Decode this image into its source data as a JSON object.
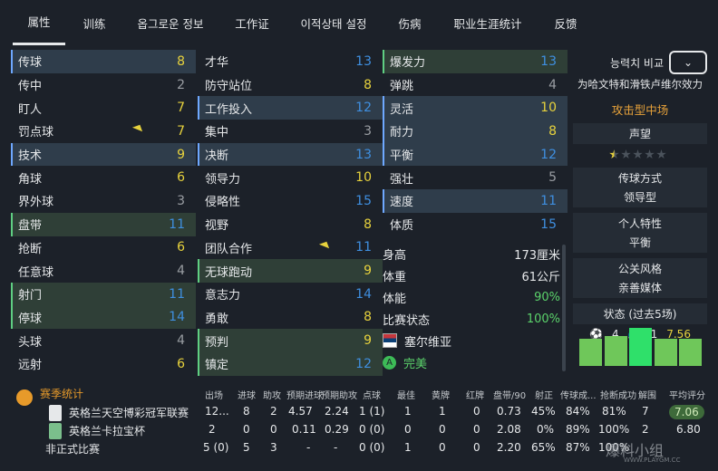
{
  "tabs": [
    "属性",
    "训练",
    "옵그로운 정보",
    "工作证",
    "이적상태 설정",
    "伤病",
    "职业生涯统计",
    "反馈"
  ],
  "technical": [
    {
      "name": "传球",
      "value": "8"
    },
    {
      "name": "传中",
      "value": "2"
    },
    {
      "name": "盯人",
      "value": "7"
    },
    {
      "name": "罚点球",
      "value": "7"
    },
    {
      "name": "技术",
      "value": "9"
    },
    {
      "name": "角球",
      "value": "6"
    },
    {
      "name": "界外球",
      "value": "3"
    },
    {
      "name": "盘带",
      "value": "11"
    },
    {
      "name": "抢断",
      "value": "6"
    },
    {
      "name": "任意球",
      "value": "4"
    },
    {
      "name": "射门",
      "value": "11"
    },
    {
      "name": "停球",
      "value": "14"
    },
    {
      "name": "头球",
      "value": "4"
    },
    {
      "name": "远射",
      "value": "6"
    }
  ],
  "mental": [
    {
      "name": "才华",
      "value": "13"
    },
    {
      "name": "防守站位",
      "value": "8"
    },
    {
      "name": "工作投入",
      "value": "12"
    },
    {
      "name": "集中",
      "value": "3"
    },
    {
      "name": "决断",
      "value": "13"
    },
    {
      "name": "领导力",
      "value": "10"
    },
    {
      "name": "侵略性",
      "value": "15"
    },
    {
      "name": "视野",
      "value": "8"
    },
    {
      "name": "团队合作",
      "value": "11"
    },
    {
      "name": "无球跑动",
      "value": "9"
    },
    {
      "name": "意志力",
      "value": "14"
    },
    {
      "name": "勇敢",
      "value": "8"
    },
    {
      "name": "预判",
      "value": "9"
    },
    {
      "name": "镇定",
      "value": "12"
    }
  ],
  "physical": [
    {
      "name": "爆发力",
      "value": "13"
    },
    {
      "name": "弹跳",
      "value": "4"
    },
    {
      "name": "灵活",
      "value": "10"
    },
    {
      "name": "耐力",
      "value": "8"
    },
    {
      "name": "平衡",
      "value": "12"
    },
    {
      "name": "强壮",
      "value": "5"
    },
    {
      "name": "速度",
      "value": "11"
    },
    {
      "name": "体质",
      "value": "15"
    }
  ],
  "info": {
    "height_label": "身高",
    "height": "173厘米",
    "weight_label": "体重",
    "weight": "61公斤",
    "fitness_label": "体能",
    "fitness": "90%",
    "condition_label": "比赛状态",
    "condition": "100%",
    "nation": "塞尔维亚",
    "status": "完美"
  },
  "right": {
    "compare_label": "능력치 비교",
    "club_text": "为哈文特和滑铁卢维尔效力",
    "role": "攻击型中场",
    "reputation_label": "声望",
    "reputation_stars": 0.5,
    "passing_label": "传球方式",
    "passing_value": "领导型",
    "trait_label": "个人特性",
    "trait_value": "平衡",
    "pr_label": "公关风格",
    "pr_value": "亲善媒体",
    "form_label": "状态 (过去5场)",
    "form_goals": "4",
    "form_assists": "1",
    "form_rating": "7.56",
    "form_bars": [
      0.72,
      0.78,
      1.0,
      0.72,
      0.72
    ]
  },
  "season": {
    "title": "赛季统计",
    "headers": [
      "出场",
      "进球",
      "助攻",
      "预期进球",
      "预期助攻",
      "点球",
      "最佳",
      "黄牌",
      "红牌",
      "盘带/90",
      "射正",
      "传球成...",
      "抢断成功",
      "解围",
      "平均评分"
    ],
    "rows": [
      {
        "name": "英格兰天空博彩冠军联赛",
        "cells": [
          "12...",
          "8",
          "2",
          "4.57",
          "2.24",
          "1 (1)",
          "1",
          "1",
          "0",
          "0.73",
          "45%",
          "84%",
          "81%",
          "7",
          "7.06"
        ]
      },
      {
        "name": "英格兰卡拉宝杯",
        "cells": [
          "2",
          "0",
          "0",
          "0.11",
          "0.29",
          "0 (0)",
          "0",
          "0",
          "0",
          "2.08",
          "0%",
          "89%",
          "100%",
          "2",
          "6.80"
        ]
      },
      {
        "name": "非正式比赛",
        "cells": [
          "5 (0)",
          "5",
          "3",
          "-",
          "-",
          "0 (0)",
          "1",
          "0",
          "0",
          "2.20",
          "65%",
          "87%",
          "100%",
          "",
          ""
        ]
      }
    ]
  },
  "watermark": "爆料小组",
  "watermark_sub": "WWW.PLAYGM.CC"
}
